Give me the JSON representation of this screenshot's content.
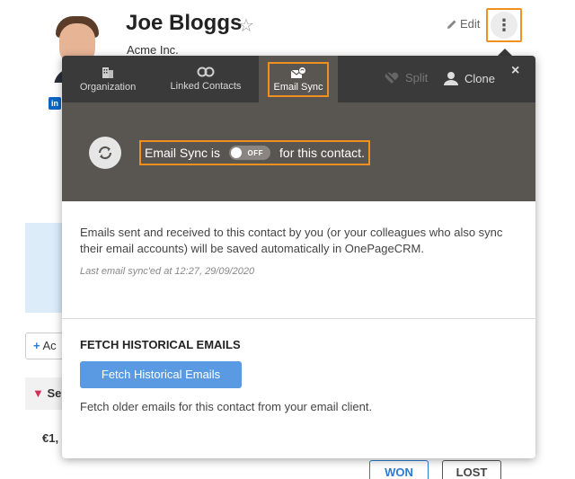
{
  "contact": {
    "name": "Joe Bloggs",
    "company": "Acme Inc.",
    "star_icon": "☆",
    "edit_label": "Edit",
    "more_icon": "⋮",
    "linkedin_label": "in"
  },
  "background": {
    "add_label": "Ac",
    "section_label": "Se",
    "amount": "€1,",
    "won_label": "WON",
    "lost_label": "LOST"
  },
  "popup": {
    "tabs": [
      {
        "label": "Organization",
        "icon": "building-icon"
      },
      {
        "label": "Linked Contacts",
        "icon": "link-icon"
      },
      {
        "label": "Email Sync",
        "icon": "email-sync-icon",
        "active": true
      }
    ],
    "split_label": "Split",
    "clone_label": "Clone",
    "close_icon": "×",
    "sync": {
      "prefix": "Email Sync is",
      "toggle_state": "OFF",
      "suffix": "for this contact."
    },
    "description": "Emails sent and received to this contact by you (or your colleagues who also sync their email accounts) will be saved automatically in OnePageCRM.",
    "last_sync": "Last email sync'ed at 12:27, 29/09/2020",
    "fetch": {
      "title": "FETCH HISTORICAL EMAILS",
      "button_label": "Fetch Historical Emails",
      "help": "Fetch older emails for this contact from your email client."
    }
  },
  "colors": {
    "accent_outline": "#f0901e",
    "tab_bar": "#3a3a3a",
    "sync_band": "#595550",
    "primary_button": "#5a9ae2"
  }
}
